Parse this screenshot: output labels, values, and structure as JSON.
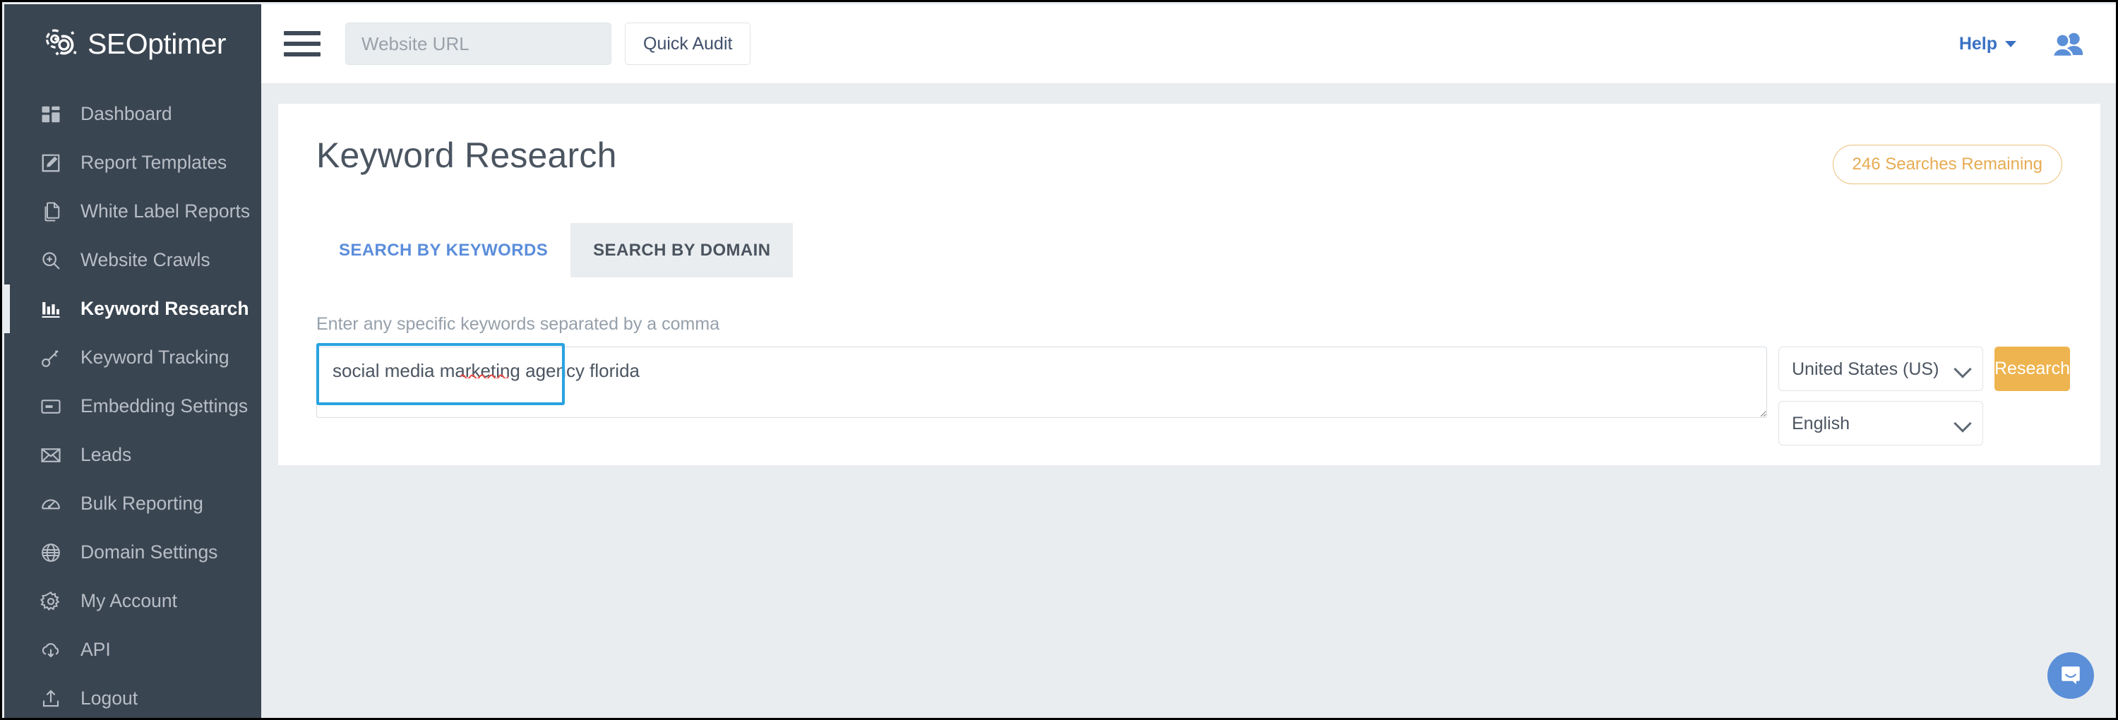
{
  "brand": {
    "name": "SEOptimer",
    "logo_icon": "gears-logo-icon"
  },
  "topbar": {
    "menu_icon": "hamburger-menu-icon",
    "url_placeholder": "Website URL",
    "url_value": "",
    "quick_audit_label": "Quick Audit",
    "help_label": "Help",
    "account_icon": "users-avatar-icon"
  },
  "sidebar": {
    "items": [
      {
        "label": "Dashboard",
        "icon": "dashboard-grid-icon",
        "active": false
      },
      {
        "label": "Report Templates",
        "icon": "edit-document-icon",
        "active": false
      },
      {
        "label": "White Label Reports",
        "icon": "copy-documents-icon",
        "active": false
      },
      {
        "label": "Website Crawls",
        "icon": "magnifier-plus-icon",
        "active": false
      },
      {
        "label": "Keyword Research",
        "icon": "bar-chart-icon",
        "active": true
      },
      {
        "label": "Keyword Tracking",
        "icon": "key-icon",
        "active": false
      },
      {
        "label": "Embedding Settings",
        "icon": "embed-box-icon",
        "active": false
      },
      {
        "label": "Leads",
        "icon": "envelope-icon",
        "active": false
      },
      {
        "label": "Bulk Reporting",
        "icon": "gauge-icon",
        "active": false
      },
      {
        "label": "Domain Settings",
        "icon": "globe-icon",
        "active": false
      },
      {
        "label": "My Account",
        "icon": "gear-icon",
        "active": false
      },
      {
        "label": "API",
        "icon": "cloud-download-icon",
        "active": false
      },
      {
        "label": "Logout",
        "icon": "logout-upload-icon",
        "active": false
      }
    ]
  },
  "main": {
    "page_title": "Keyword Research",
    "searches_badge": "246 Searches Remaining",
    "tabs": [
      {
        "label": "SEARCH BY KEYWORDS",
        "selected": false
      },
      {
        "label": "SEARCH BY DOMAIN",
        "selected": true
      }
    ],
    "hint": "Enter any specific keywords separated by a comma",
    "keywords_value": "social media marketing agency florida",
    "keywords_placeholder": "",
    "country_value": "United States (US)",
    "language_value": "English",
    "research_label": "Research"
  },
  "chat": {
    "icon": "intercom-chat-icon"
  },
  "colors": {
    "sidebar_bg": "#3a4552",
    "page_bg": "#eaedf0",
    "accent_orange": "#eeb44f",
    "badge_orange": "#e7ab52",
    "link_blue": "#5b8ddb",
    "focus_blue": "#29a3e0",
    "help_blue": "#3a71c4",
    "chat_blue": "#5b8fd8"
  }
}
